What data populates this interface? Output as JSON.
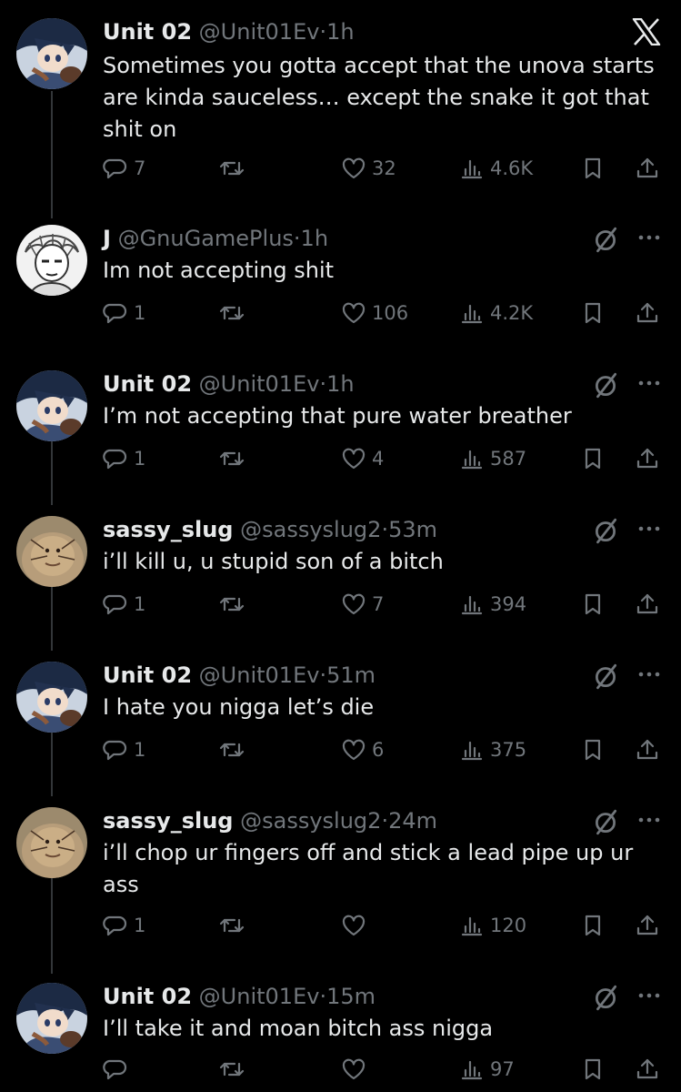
{
  "app": {
    "logo": "x-logo-icon"
  },
  "posts": [
    {
      "name": "Unit 02",
      "handle": "@Unit01Ev",
      "dot": "·",
      "time": "1h",
      "text": "Sometimes you gotta accept that the unova starts are kinda sauceless… except the snake it got that shit on",
      "replies": "7",
      "reposts": "",
      "likes": "32",
      "views": "4.6K",
      "avatar": "anime-character-avatar"
    },
    {
      "name": "J",
      "handle": "@GnuGamePlus",
      "dot": "·",
      "time": "1h",
      "text": "Im not accepting shit",
      "replies": "1",
      "reposts": "",
      "likes": "106",
      "views": "4.2K",
      "avatar": "manga-sketch-avatar"
    },
    {
      "name": "Unit 02",
      "handle": "@Unit01Ev",
      "dot": "·",
      "time": "1h",
      "text": "I’m not accepting that pure water breather",
      "replies": "1",
      "reposts": "",
      "likes": "4",
      "views": "587",
      "avatar": "anime-character-avatar"
    },
    {
      "name": "sassy_slug",
      "handle": "@sassyslug2",
      "dot": "·",
      "time": "53m",
      "text": "i’ll kill u, u stupid son of a bitch",
      "replies": "1",
      "reposts": "",
      "likes": "7",
      "views": "394",
      "avatar": "slug-avatar"
    },
    {
      "name": "Unit 02",
      "handle": "@Unit01Ev",
      "dot": "·",
      "time": "51m",
      "text": "I hate you nigga let’s die",
      "replies": "1",
      "reposts": "",
      "likes": "6",
      "views": "375",
      "avatar": "anime-character-avatar"
    },
    {
      "name": "sassy_slug",
      "handle": "@sassyslug2",
      "dot": "·",
      "time": "24m",
      "text": "i’ll chop ur fingers off and stick a lead pipe up ur ass",
      "replies": "1",
      "reposts": "",
      "likes": "",
      "views": "120",
      "avatar": "slug-avatar"
    },
    {
      "name": "Unit 02",
      "handle": "@Unit01Ev",
      "dot": "·",
      "time": "15m",
      "text": "I’ll take it and moan bitch ass nigga",
      "replies": "",
      "reposts": "",
      "likes": "",
      "views": "97",
      "avatar": "anime-character-avatar"
    }
  ],
  "colors": {
    "background": "#000000",
    "text": "#e7e9ea",
    "muted": "#71767b",
    "thread_line": "#333639"
  }
}
